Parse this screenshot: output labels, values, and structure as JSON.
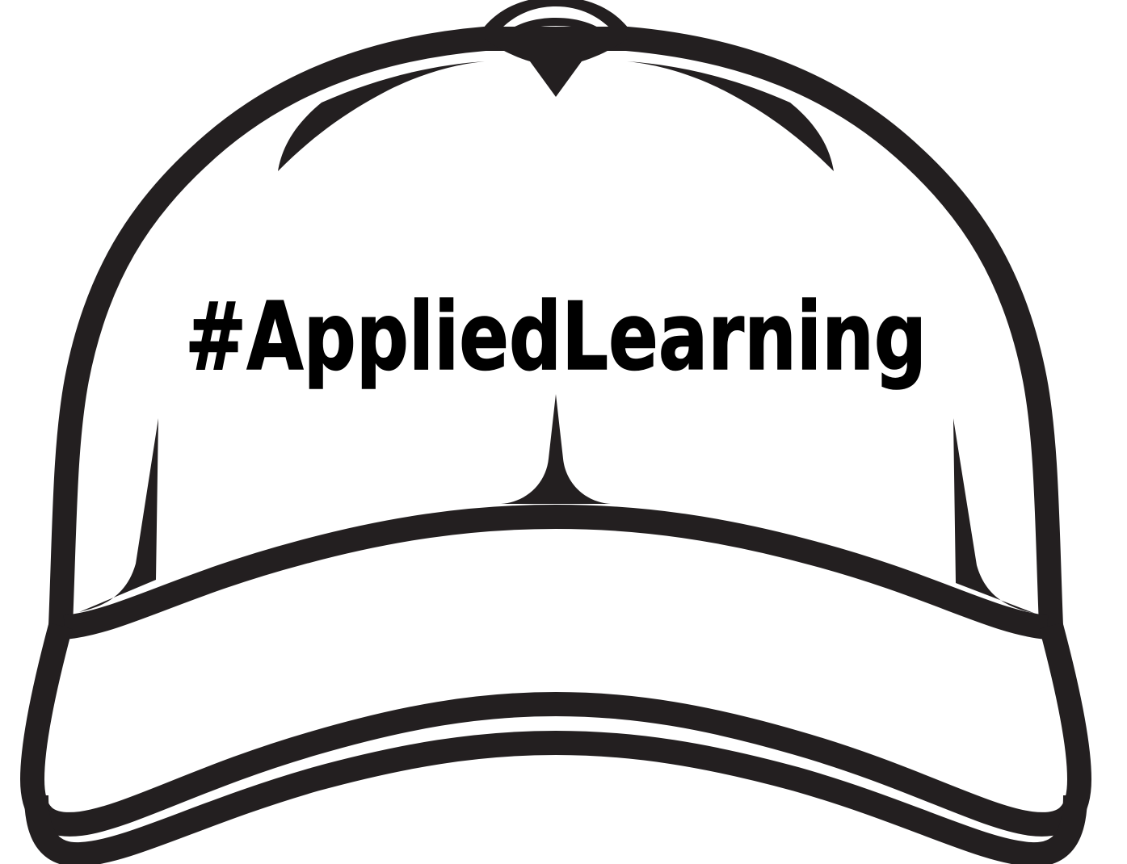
{
  "hat": {
    "text": "#AppliedLearning",
    "text_color": "#000000",
    "outline_color": "#231f20",
    "fill_color": "#ffffff"
  }
}
